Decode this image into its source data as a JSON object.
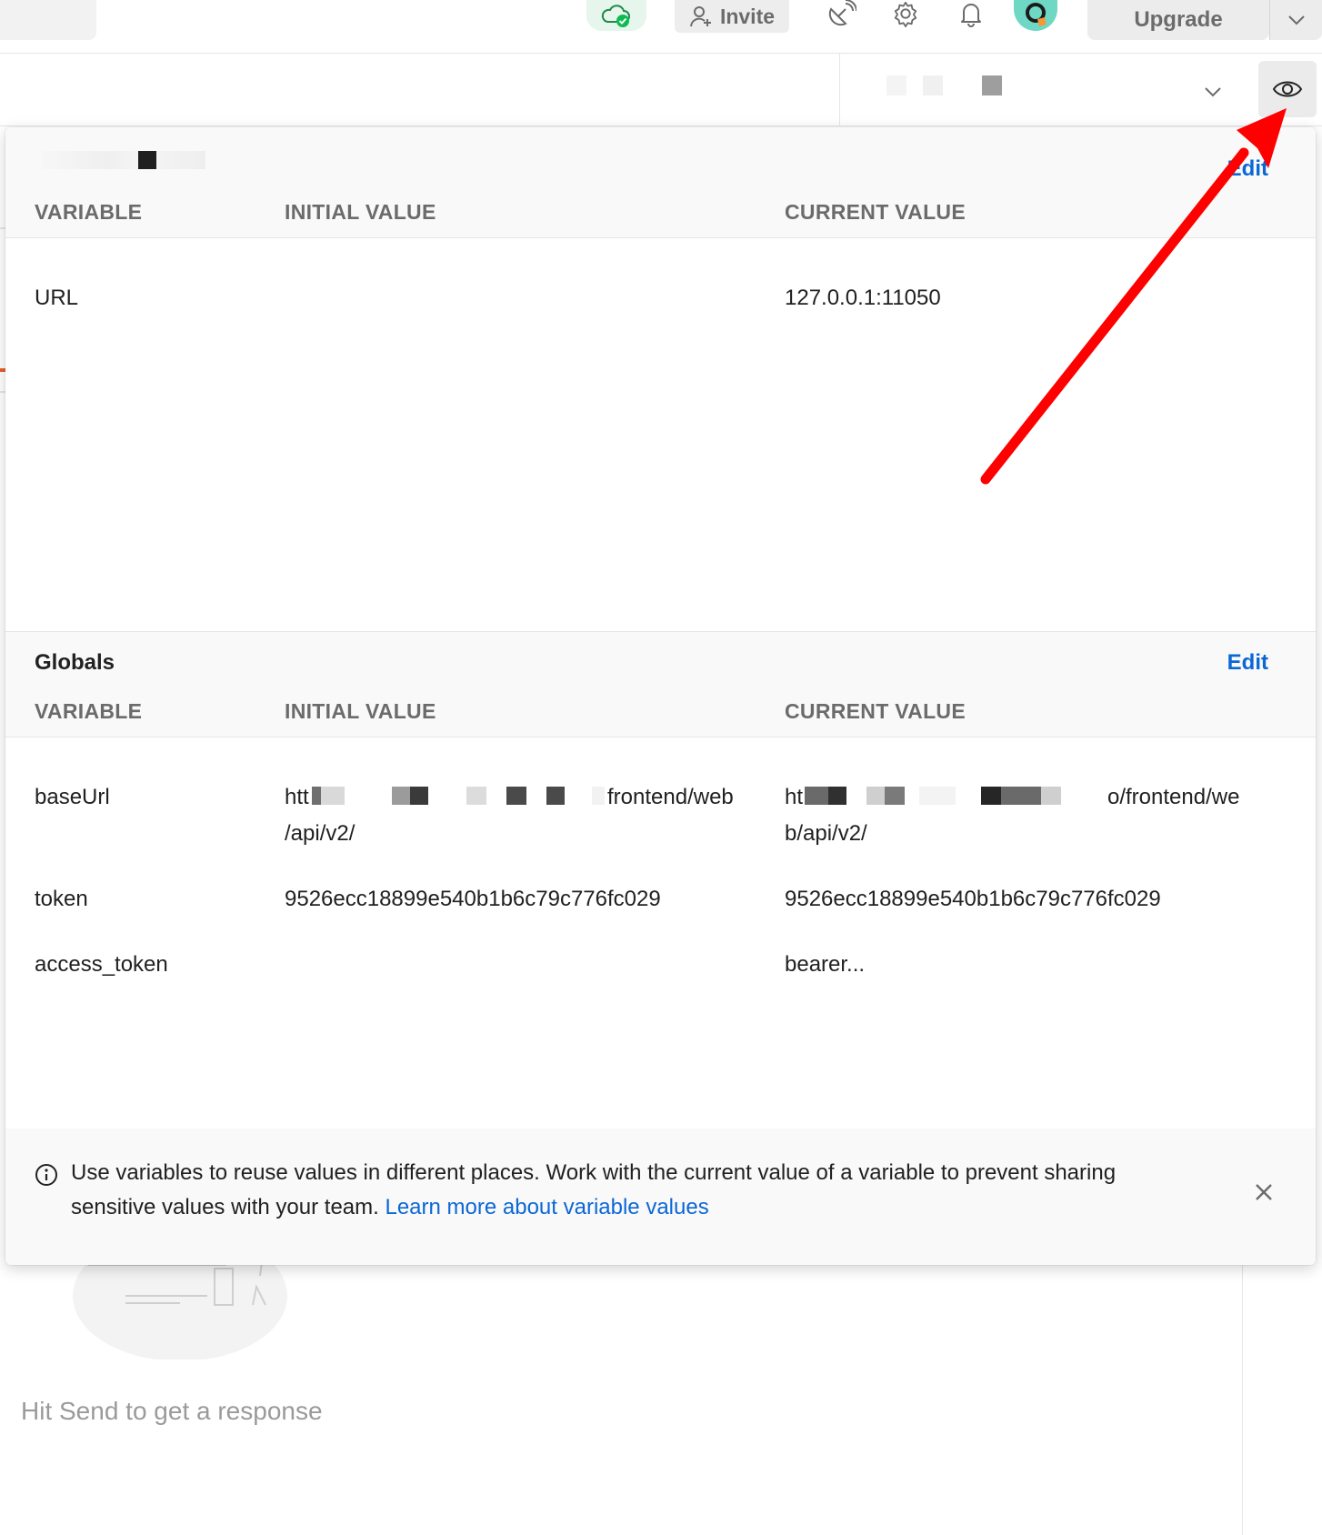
{
  "topbar": {
    "invite_label": "Invite",
    "upgrade_label": "Upgrade",
    "icons": [
      "cloud-sync-icon",
      "satellite-icon",
      "gear-icon",
      "bell-icon",
      "avatar",
      "chevron-down-icon"
    ]
  },
  "env_bar": {
    "selected_environment": "",
    "icons": [
      "chevron-down-icon",
      "eye-icon"
    ]
  },
  "quick_look": {
    "environment": {
      "title": "",
      "edit_label": "Edit",
      "columns": [
        "VARIABLE",
        "INITIAL VALUE",
        "CURRENT VALUE"
      ],
      "rows": [
        {
          "variable": "URL",
          "initial": "",
          "current": "127.0.0.1:11050"
        }
      ]
    },
    "globals": {
      "title": "Globals",
      "edit_label": "Edit",
      "columns": [
        "VARIABLE",
        "INITIAL VALUE",
        "CURRENT VALUE"
      ],
      "rows": [
        {
          "variable": "baseUrl",
          "initial_prefix": "htt",
          "initial_suffix": "frontend/web",
          "initial_line2": "/api/v2/",
          "current_prefix": "ht",
          "current_suffix": "o/frontend/we",
          "current_line2": "b/api/v2/"
        },
        {
          "variable": "token",
          "initial": "9526ecc18899e540b1b6c79c776fc029",
          "current": "9526ecc18899e540b1b6c79c776fc029"
        },
        {
          "variable": "access_token",
          "initial": "",
          "current": "bearer..."
        }
      ]
    },
    "info": {
      "text": "Use variables to reuse values in different places. Work with the current value of a variable to prevent sharing sensitive values with your team.",
      "link_label": "Learn more about variable values",
      "icons": [
        "info-icon",
        "close-icon"
      ]
    }
  },
  "response_panel": {
    "placeholder": "Hit Send to get a response"
  },
  "annotation": {
    "arrow_color": "#ff0000"
  },
  "colors": {
    "accent_blue": "#0b67d6",
    "sync_green": "#0cbb52"
  }
}
